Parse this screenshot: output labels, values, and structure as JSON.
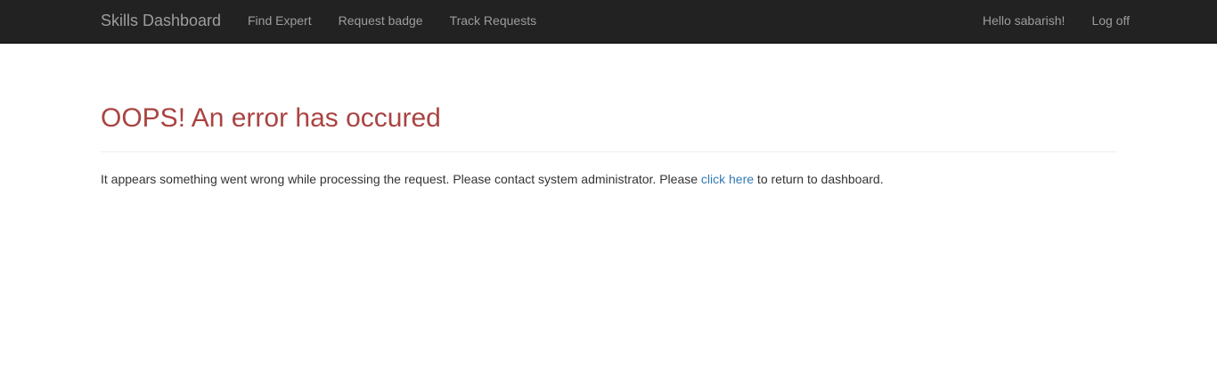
{
  "navbar": {
    "brand": "Skills Dashboard",
    "left_links": [
      "Find Expert",
      "Request badge",
      "Track Requests"
    ],
    "greeting": "Hello sabarish!",
    "logoff": "Log off"
  },
  "error": {
    "title": "OOPS! An error has occured",
    "message_before": "It appears something went wrong while processing the request. Please contact system administrator. Please ",
    "link_text": "click here",
    "message_after": " to return to dashboard."
  },
  "colors": {
    "navbar_bg": "#222222",
    "nav_text": "#9d9d9d",
    "error_title": "#a94442",
    "link": "#337ab7",
    "body_text": "#333333"
  }
}
